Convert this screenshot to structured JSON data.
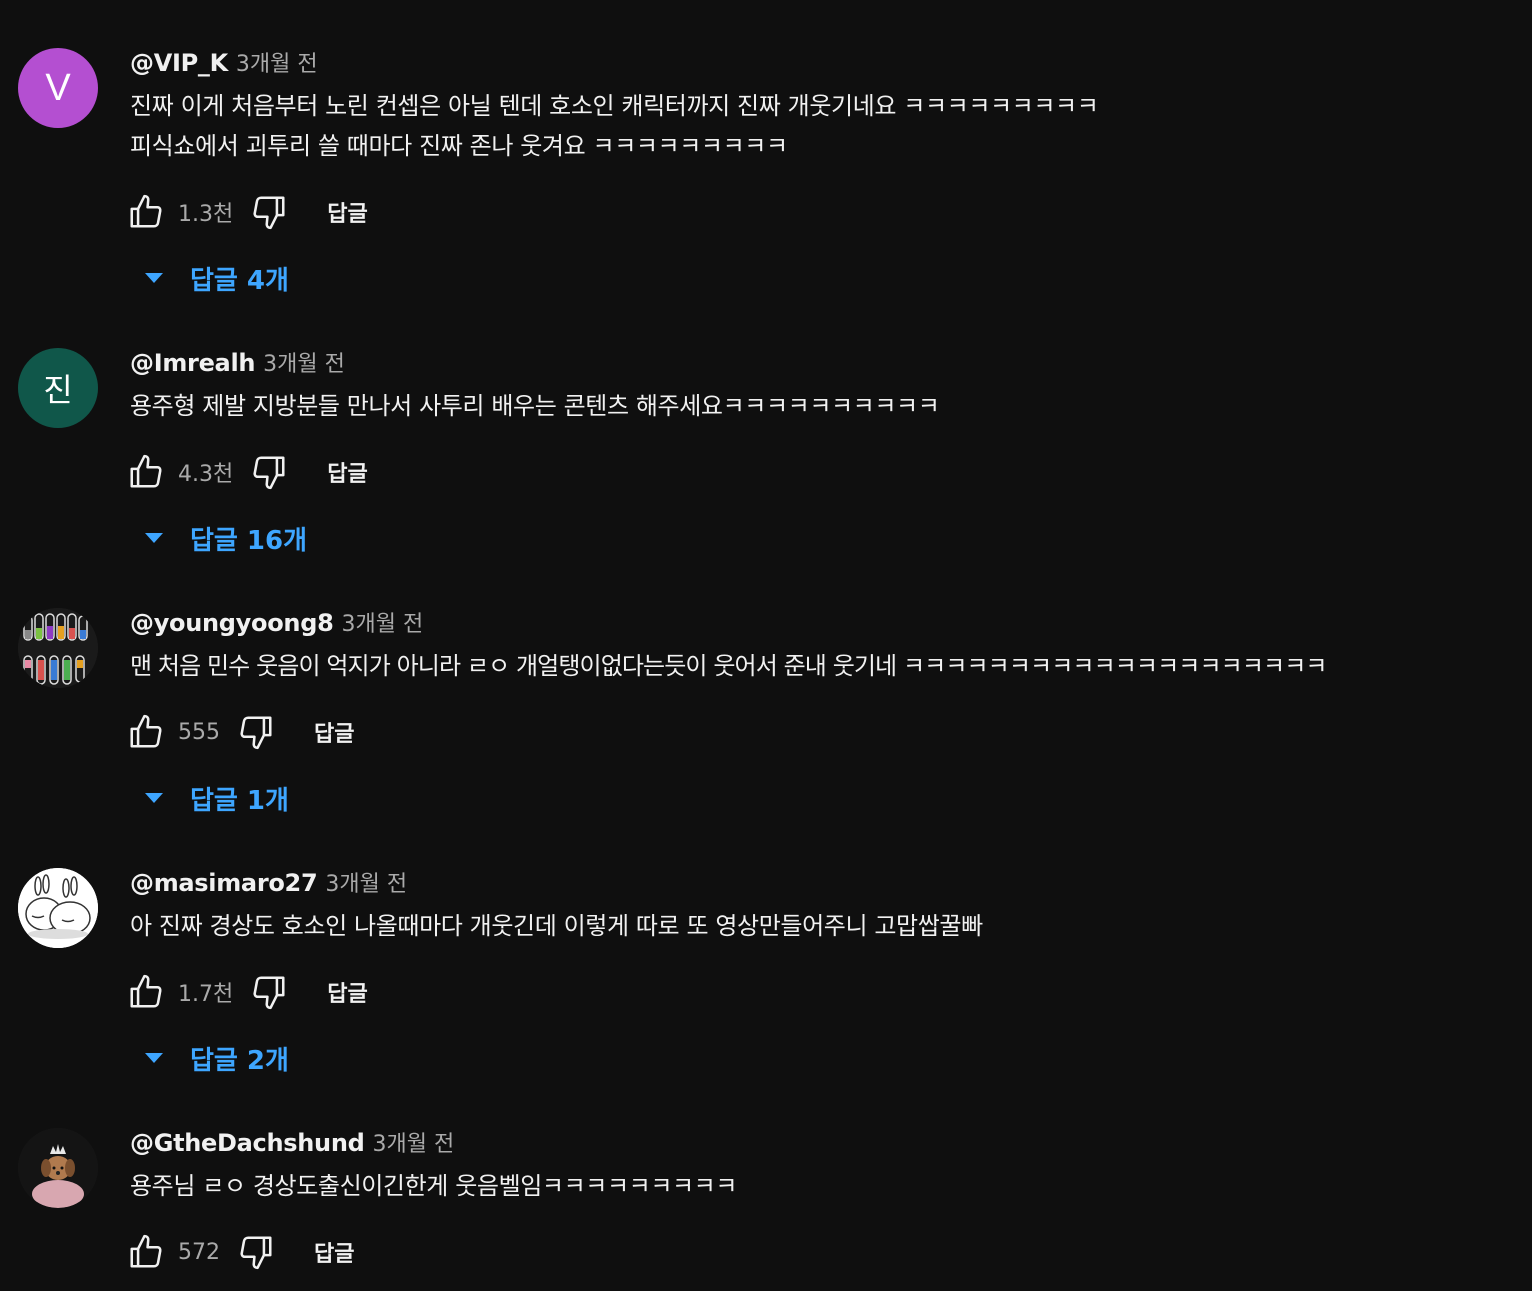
{
  "colors": {
    "background": "#0f0f0f",
    "text_primary": "#f1f1f1",
    "text_secondary": "#aaaaaa",
    "link_blue": "#3ea6ff"
  },
  "reply_label": "답글",
  "comments": [
    {
      "author": "@VIP_K",
      "time": "3개월 전",
      "avatar": {
        "type": "letter",
        "letter": "V",
        "color": "#b44fd1"
      },
      "text": "진짜 이게 처음부터 노린 컨셉은 아닐 텐데 호소인 캐릭터까지 진짜 개웃기네요 ㅋㅋㅋㅋㅋㅋㅋㅋㅋ\n피식쇼에서 괴투리 쓸 때마다 진짜 존나 웃겨요 ㅋㅋㅋㅋㅋㅋㅋㅋㅋ",
      "likes": "1.3천",
      "replies": "답글 4개"
    },
    {
      "author": "@Imrealh",
      "time": "3개월 전",
      "avatar": {
        "type": "letter",
        "letter": "진",
        "color": "#10574a"
      },
      "text": "용주형 제발 지방분들 만나서 사투리 배우는 콘텐츠 해주세요ㅋㅋㅋㅋㅋㅋㅋㅋㅋㅋ",
      "likes": "4.3천",
      "replies": "답글 16개"
    },
    {
      "author": "@youngyoong8",
      "time": "3개월 전",
      "avatar": {
        "type": "image",
        "icon": "test-tubes-icon"
      },
      "text": "맨 처음 민수 웃음이 억지가 아니라 ㄹㅇ 개얼탱이없다는듯이 웃어서 준내 웃기네 ㅋㅋㅋㅋㅋㅋㅋㅋㅋㅋㅋㅋㅋㅋㅋㅋㅋㅋㅋㅋ",
      "likes": "555",
      "replies": "답글 1개"
    },
    {
      "author": "@masimaro27",
      "time": "3개월 전",
      "avatar": {
        "type": "image",
        "icon": "rabbit-icon"
      },
      "text": "아 진짜 경상도 호소인 나올때마다 개웃긴데 이렇게 따로 또 영상만들어주니 고맙쌉꿀빠",
      "likes": "1.7천",
      "replies": "답글 2개"
    },
    {
      "author": "@GtheDachshund",
      "time": "3개월 전",
      "avatar": {
        "type": "image",
        "icon": "dog-princess-icon"
      },
      "text": "용주님 ㄹㅇ 경상도출신이긴한게 웃음벨임ㅋㅋㅋㅋㅋㅋㅋㅋㅋ",
      "likes": "572",
      "replies": ""
    }
  ]
}
